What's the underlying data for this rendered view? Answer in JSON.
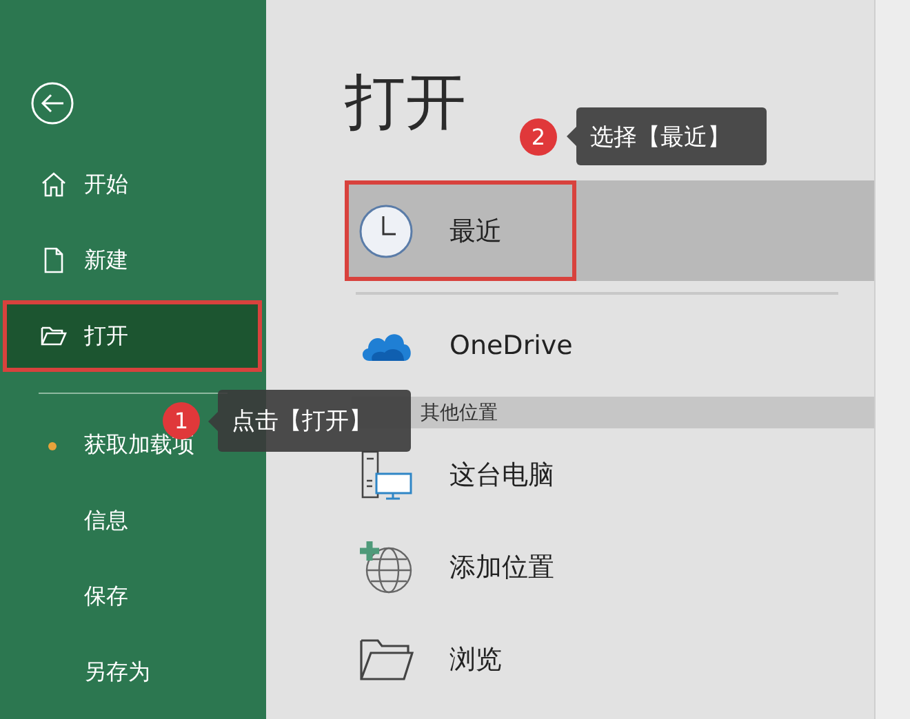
{
  "sidebar": {
    "items": [
      {
        "label": "开始",
        "kind": "home",
        "selected": false,
        "highlighted": false
      },
      {
        "label": "新建",
        "kind": "new",
        "selected": false,
        "highlighted": false
      },
      {
        "label": "打开",
        "kind": "open",
        "selected": true,
        "highlighted": true
      }
    ],
    "more_items": [
      {
        "label": "获取加载项",
        "marked": true
      },
      {
        "label": "信息",
        "marked": false
      },
      {
        "label": "保存",
        "marked": false
      },
      {
        "label": "另存为",
        "marked": false
      }
    ]
  },
  "main": {
    "title": "打开",
    "locations": [
      {
        "label": "最近",
        "kind": "recent",
        "selected": true,
        "highlighted": true
      },
      {
        "label": "OneDrive",
        "kind": "cloud",
        "selected": false,
        "highlighted": false
      }
    ],
    "section": "其他位置",
    "other_locations": [
      {
        "label": "这台电脑",
        "kind": "computer"
      },
      {
        "label": "添加位置",
        "kind": "add-place"
      },
      {
        "label": "浏览",
        "kind": "browse"
      }
    ]
  },
  "callouts": [
    {
      "number": "1",
      "text": "点击【打开】"
    },
    {
      "number": "2",
      "text": "选择【最近】"
    }
  ]
}
